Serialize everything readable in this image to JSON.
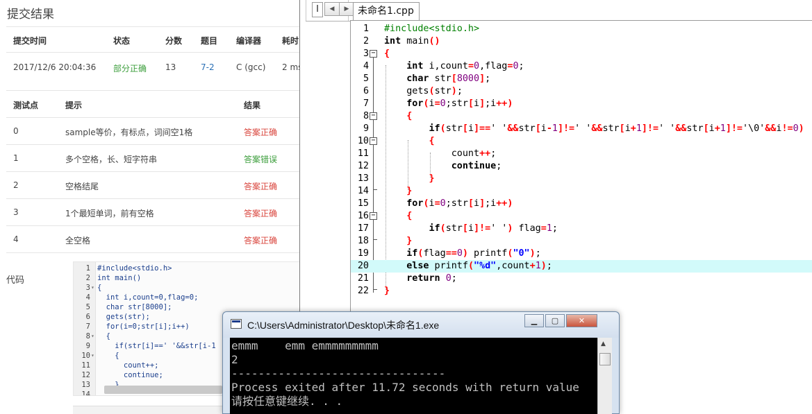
{
  "judge": {
    "title": "提交结果",
    "submission_headers": [
      "提交时间",
      "状态",
      "分数",
      "题目",
      "编译器",
      "耗时"
    ],
    "submission": {
      "time": "2017/12/6 20:04:36",
      "status": "部分正确",
      "score": "13",
      "problem": "7-2",
      "compiler": "C (gcc)",
      "elapsed": "2 ms"
    },
    "test_headers": [
      "测试点",
      "提示",
      "结果"
    ],
    "tests": [
      {
        "id": "0",
        "hint": "sample等价，有标点，词间空1格",
        "result": "答案正确"
      },
      {
        "id": "1",
        "hint": "多个空格，长、短字符串",
        "result": "答案错误"
      },
      {
        "id": "2",
        "hint": "空格结尾",
        "result": "答案正确"
      },
      {
        "id": "3",
        "hint": "1个最短单词，前有空格",
        "result": "答案正确"
      },
      {
        "id": "4",
        "hint": "全空格",
        "result": "答案正确"
      }
    ],
    "code_label": "代码",
    "mini_code": [
      {
        "n": "1",
        "fold": "",
        "text": "#include<stdio.h>"
      },
      {
        "n": "2",
        "fold": "",
        "text": "int main()"
      },
      {
        "n": "3",
        "fold": "▾",
        "text": "{"
      },
      {
        "n": "4",
        "fold": "",
        "text": "  int i,count=0,flag=0;"
      },
      {
        "n": "5",
        "fold": "",
        "text": "  char str[8000];"
      },
      {
        "n": "6",
        "fold": "",
        "text": "  gets(str);"
      },
      {
        "n": "7",
        "fold": "",
        "text": "  for(i=0;str[i];i++)"
      },
      {
        "n": "8",
        "fold": "▾",
        "text": "  {"
      },
      {
        "n": "9",
        "fold": "",
        "text": "    if(str[i]==' '&&str[i-1"
      },
      {
        "n": "10",
        "fold": "▾",
        "text": "    {"
      },
      {
        "n": "11",
        "fold": "",
        "text": "      count++;"
      },
      {
        "n": "12",
        "fold": "",
        "text": "      continue;"
      },
      {
        "n": "13",
        "fold": "",
        "text": "    }"
      },
      {
        "n": "14",
        "fold": "",
        "text": ""
      }
    ]
  },
  "ide": {
    "left_tab": "I",
    "nav_prev": "◀",
    "nav_next": "▶",
    "tab_title": "未命名1.cpp",
    "highlighted_line": 20,
    "lines": [
      {
        "n": "1",
        "fold": "",
        "html": "<span class='pp'>#include&lt;stdio.h&gt;</span>"
      },
      {
        "n": "2",
        "fold": "",
        "html": "<span class='kw'>int</span> main<span class='op'>()</span>"
      },
      {
        "n": "3",
        "fold": "−",
        "html": "<span class='op'>{</span>"
      },
      {
        "n": "4",
        "fold": "",
        "html": "    <span class='kw'>int</span> i,count<span class='op'>=</span><span class='num'>0</span>,flag<span class='op'>=</span><span class='num'>0</span>;"
      },
      {
        "n": "5",
        "fold": "",
        "html": "    <span class='kw'>char</span> str<span class='op'>[</span><span class='num'>8000</span><span class='op'>]</span>;"
      },
      {
        "n": "6",
        "fold": "",
        "html": "    gets<span class='op'>(</span>str<span class='op'>)</span>;"
      },
      {
        "n": "7",
        "fold": "",
        "html": "    <span class='kw'>for</span><span class='op'>(</span>i<span class='op'>=</span><span class='num'>0</span>;str<span class='op'>[</span>i<span class='op'>]</span>;i<span class='op'>++)</span>"
      },
      {
        "n": "8",
        "fold": "−",
        "html": "    <span class='op'>{</span>"
      },
      {
        "n": "9",
        "fold": "",
        "html": "        <span class='kw'>if</span><span class='op'>(</span>str<span class='op'>[</span>i<span class='op'>]==</span>' '<span class='op'>&amp;&amp;</span>str<span class='op'>[</span>i<span class='op'>-</span><span class='num'>1</span><span class='op'>]!=</span>' '<span class='op'>&amp;&amp;</span>str<span class='op'>[</span>i<span class='op'>+</span><span class='num'>1</span><span class='op'>]!=</span>' '<span class='op'>&amp;&amp;</span>str<span class='op'>[</span>i<span class='op'>+</span><span class='num'>1</span><span class='op'>]!=</span>'\\0'<span class='op'>&amp;&amp;</span>i<span class='op'>!=</span><span class='num'>0</span><span class='op'>)</span>"
      },
      {
        "n": "10",
        "fold": "−",
        "html": "        <span class='op'>{</span>"
      },
      {
        "n": "11",
        "fold": "",
        "html": "            count<span class='op'>++</span>;"
      },
      {
        "n": "12",
        "fold": "",
        "html": "            <span class='kw'>continue</span>;"
      },
      {
        "n": "13",
        "fold": "",
        "html": "        <span class='op'>}</span>"
      },
      {
        "n": "14",
        "fold": "",
        "html": "    <span class='op'>}</span>"
      },
      {
        "n": "15",
        "fold": "",
        "html": "    <span class='kw'>for</span><span class='op'>(</span>i<span class='op'>=</span><span class='num'>0</span>;str<span class='op'>[</span>i<span class='op'>]</span>;i<span class='op'>++)</span>"
      },
      {
        "n": "16",
        "fold": "−",
        "html": "    <span class='op'>{</span>"
      },
      {
        "n": "17",
        "fold": "",
        "html": "        <span class='kw'>if</span><span class='op'>(</span>str<span class='op'>[</span>i<span class='op'>]!=</span>' '<span class='op'>)</span> flag<span class='op'>=</span><span class='num'>1</span>;"
      },
      {
        "n": "18",
        "fold": "",
        "html": "    <span class='op'>}</span>"
      },
      {
        "n": "19",
        "fold": "",
        "html": "    <span class='kw'>if</span><span class='op'>(</span>flag<span class='op'>==</span><span class='num'>0</span><span class='op'>)</span> printf<span class='op'>(</span><span class='str'>\"0\"</span><span class='op'>)</span>;"
      },
      {
        "n": "20",
        "fold": "",
        "html": "    <span class='kw'>else</span> printf<span class='op'>(</span><span class='str'>\"%d\"</span>,count<span class='op'>+</span><span class='num'>1</span><span class='op'>)</span>;"
      },
      {
        "n": "21",
        "fold": "",
        "html": "    <span class='kw'>return</span> <span class='num'>0</span>;"
      },
      {
        "n": "22",
        "fold": "",
        "html": "<span class='op'>}</span>"
      }
    ]
  },
  "console": {
    "title": "C:\\Users\\Administrator\\Desktop\\未命名1.exe",
    "min_label": "▁",
    "max_label": "▢",
    "close_label": "✕",
    "lines": [
      "emmm    emm emmmmmmmmm",
      "2",
      "--------------------------------",
      "Process exited after 11.72 seconds with return value",
      "请按任意键继续. . ."
    ]
  }
}
